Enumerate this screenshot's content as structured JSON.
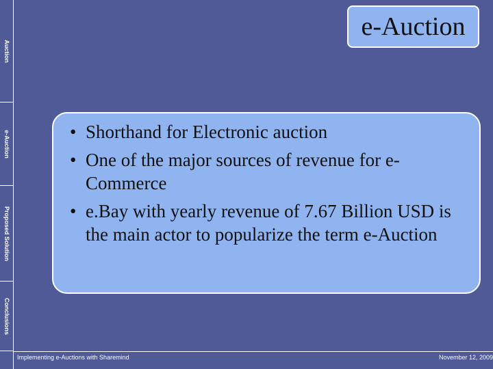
{
  "slide": {
    "title": "e-Auction"
  },
  "sidebar": {
    "items": [
      {
        "label": "Auction"
      },
      {
        "label": "e-Auction"
      },
      {
        "label": "Proposed Solution"
      },
      {
        "label": "Conclusions"
      }
    ]
  },
  "content": {
    "bullet_symbol": "•",
    "bullets": [
      "Shorthand for Electronic auction",
      "One of the major sources of revenue for e-Commerce",
      "e.Bay with yearly revenue of 7.67 Billion USD is the main actor to popularize the term e-Auction"
    ]
  },
  "footer": {
    "left": "Implementing e-Auctions with Sharemind",
    "right": "November 12, 2009"
  },
  "colors": {
    "background": "#4f5a96",
    "box_fill": "#8fb4f0",
    "border": "#ffffff",
    "text": "#111111"
  }
}
